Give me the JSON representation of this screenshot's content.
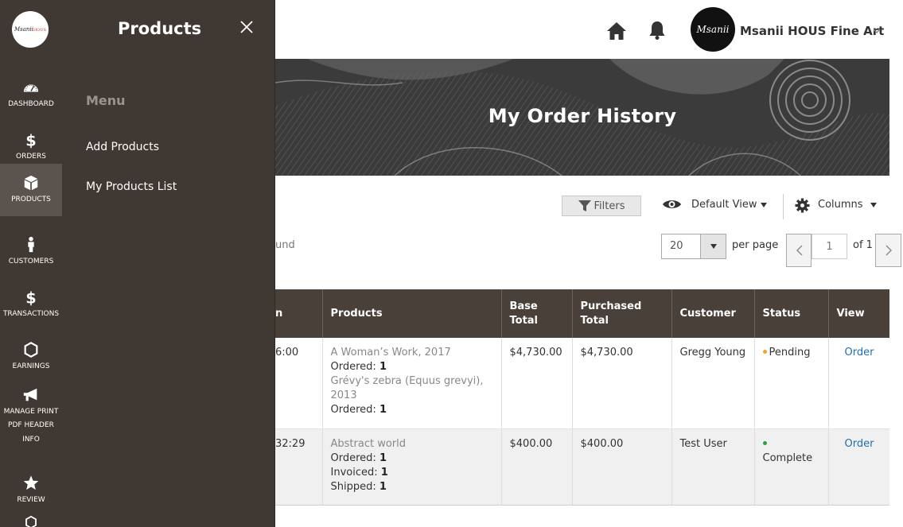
{
  "rail": {
    "logo_text": "Msanii",
    "logo_accent": "HOUS",
    "items": [
      {
        "label": "DASHBOARD",
        "icon": "speedometer-icon"
      },
      {
        "label": "ORDERS",
        "icon": "dollar-icon"
      },
      {
        "label": "PRODUCTS",
        "icon": "box-icon",
        "active": true
      },
      {
        "label": "CUSTOMERS",
        "icon": "person-icon"
      },
      {
        "label": "TRANSACTIONS",
        "icon": "dollar-icon"
      },
      {
        "label": "EARNINGS",
        "icon": "hexagon-icon"
      },
      {
        "label_lines": [
          "MANAGE PRINT",
          "PDF HEADER",
          "INFO"
        ],
        "icon": "megaphone-icon"
      },
      {
        "label": "REVIEW",
        "icon": "star-icon"
      }
    ]
  },
  "flyout": {
    "title": "Products",
    "menu_heading": "Menu",
    "links": [
      "Add Products",
      "My Products List"
    ]
  },
  "header": {
    "account_name": "Msanii HOUS Fine Art",
    "avatar_text": "Msanii"
  },
  "banner": {
    "title": "My Order History"
  },
  "toolbar": {
    "filters_label": "Filters",
    "view_label": "Default View",
    "columns_label": "Columns"
  },
  "results": {
    "found_text": "und"
  },
  "pager": {
    "per_page_value": "20",
    "per_page_label": "per page",
    "current_page": "1",
    "of_label": "of 1"
  },
  "table": {
    "headers": [
      "n",
      "Products",
      [
        "Base",
        "Total"
      ],
      [
        "Purchased",
        "Total"
      ],
      "Customer",
      "Status",
      "View"
    ],
    "rows": [
      {
        "date": "6:00",
        "products": [
          {
            "name": "A Woman’s Work, 2017",
            "meta": [
              {
                "k": "Ordered:",
                "v": "1"
              }
            ]
          },
          {
            "name": "Grévy's zebra (Equus grevyi), 2013",
            "meta": [
              {
                "k": "Ordered:",
                "v": "1"
              }
            ]
          }
        ],
        "base_total": "$4,730.00",
        "purchased_total": "$4,730.00",
        "customer": "Gregg Young",
        "status": "Pending",
        "status_color": "#f5a623",
        "view": "Order"
      },
      {
        "date": "32:29",
        "products": [
          {
            "name": "Abstract world",
            "meta": [
              {
                "k": "Ordered:",
                "v": "1"
              },
              {
                "k": "Invoiced:",
                "v": "1"
              },
              {
                "k": "Shipped:",
                "v": "1"
              }
            ]
          }
        ],
        "base_total": "$400.00",
        "purchased_total": "$400.00",
        "customer": "Test User",
        "status": "Complete",
        "status_color": "#2ea043",
        "view": "Order"
      }
    ]
  }
}
